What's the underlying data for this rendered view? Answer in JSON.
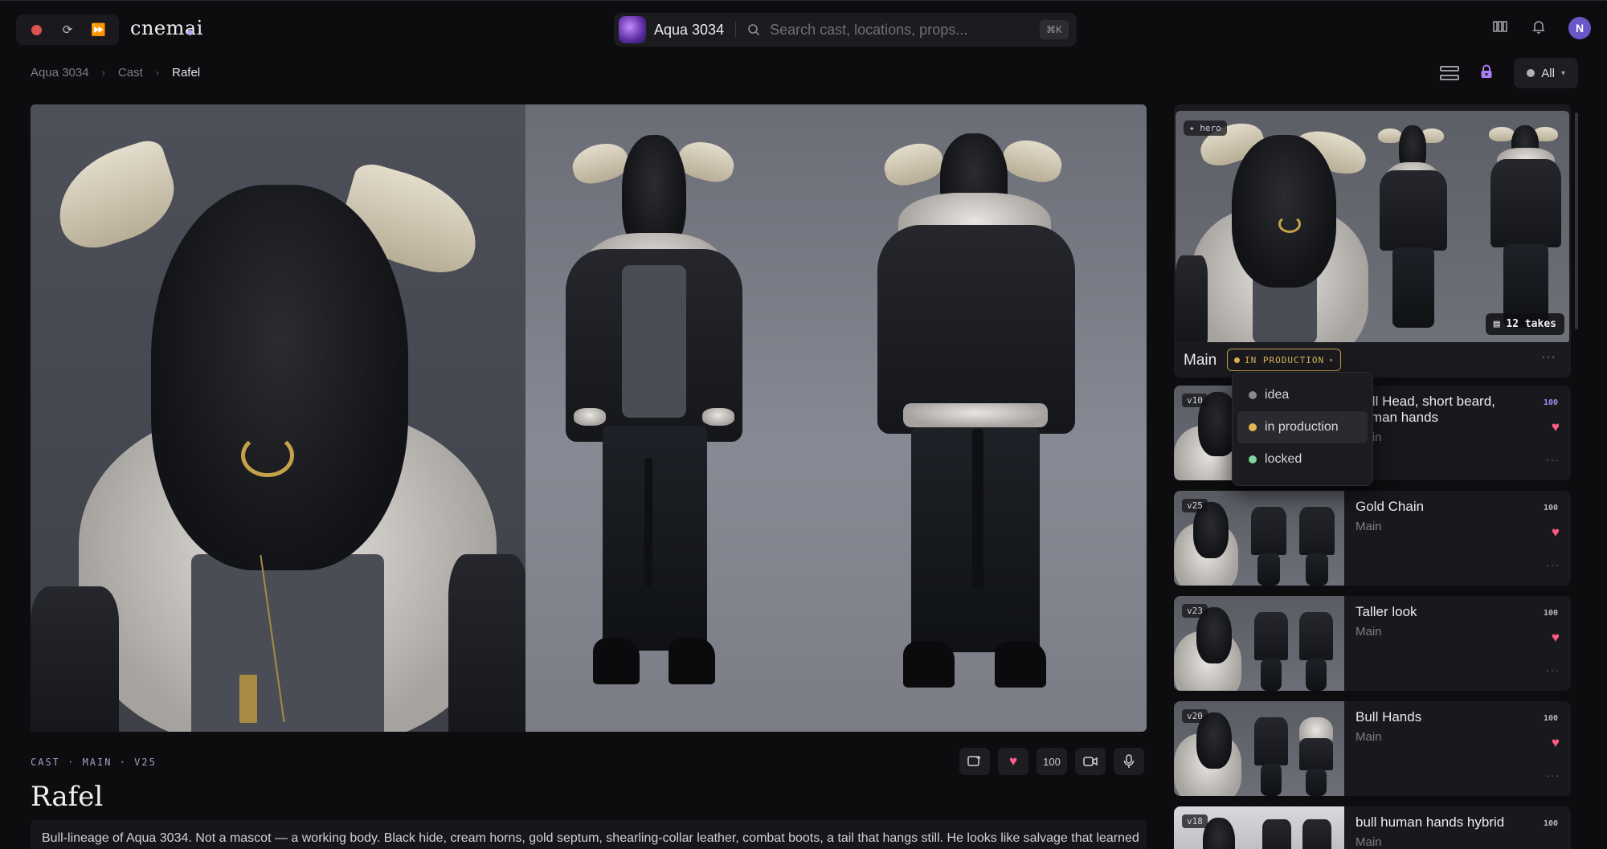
{
  "app": {
    "brand": "cnemai",
    "project_name": "Aqua 3034",
    "search_placeholder": "Search cast, locations, props...",
    "search_shortcut": "⌘K",
    "user_initial": "N"
  },
  "breadcrumb": [
    "Aqua 3034",
    "Cast",
    "Rafel"
  ],
  "filter": {
    "label": "All"
  },
  "character": {
    "meta": "CAST · MAIN · V25",
    "name": "Rafel",
    "description": "Bull-lineage of Aqua 3034. Not a mascot — a working body. Black hide, cream horns, gold septum, shearling-collar leather, combat boots, a tail that hangs still. He looks like salvage that learned"
  },
  "actions": {
    "score": "100"
  },
  "hero": {
    "tag": "✦ hero",
    "takes": "12 takes",
    "label": "Main",
    "status": "IN PRODUCTION"
  },
  "status_menu": [
    {
      "label": "idea",
      "color": "#8a8a92"
    },
    {
      "label": "in production",
      "color": "#e0b54e"
    },
    {
      "label": "locked",
      "color": "#7ed6a0"
    }
  ],
  "takes": [
    {
      "version": "v10",
      "title": "Bull Head, short beard, human hands",
      "subtitle": "Main",
      "score": "100"
    },
    {
      "version": "v25",
      "title": "Gold Chain",
      "subtitle": "Main",
      "score": "100"
    },
    {
      "version": "v23",
      "title": "Taller look",
      "subtitle": "Main",
      "score": "100"
    },
    {
      "version": "v20",
      "title": "Bull Hands",
      "subtitle": "Main",
      "score": "100"
    },
    {
      "version": "v18",
      "title": "bull human hands hybrid",
      "subtitle": "Main",
      "score": "100"
    }
  ],
  "colors": {
    "accent": "#a98af0",
    "heart": "#ff5b86",
    "status_gold": "#d9b65d"
  }
}
